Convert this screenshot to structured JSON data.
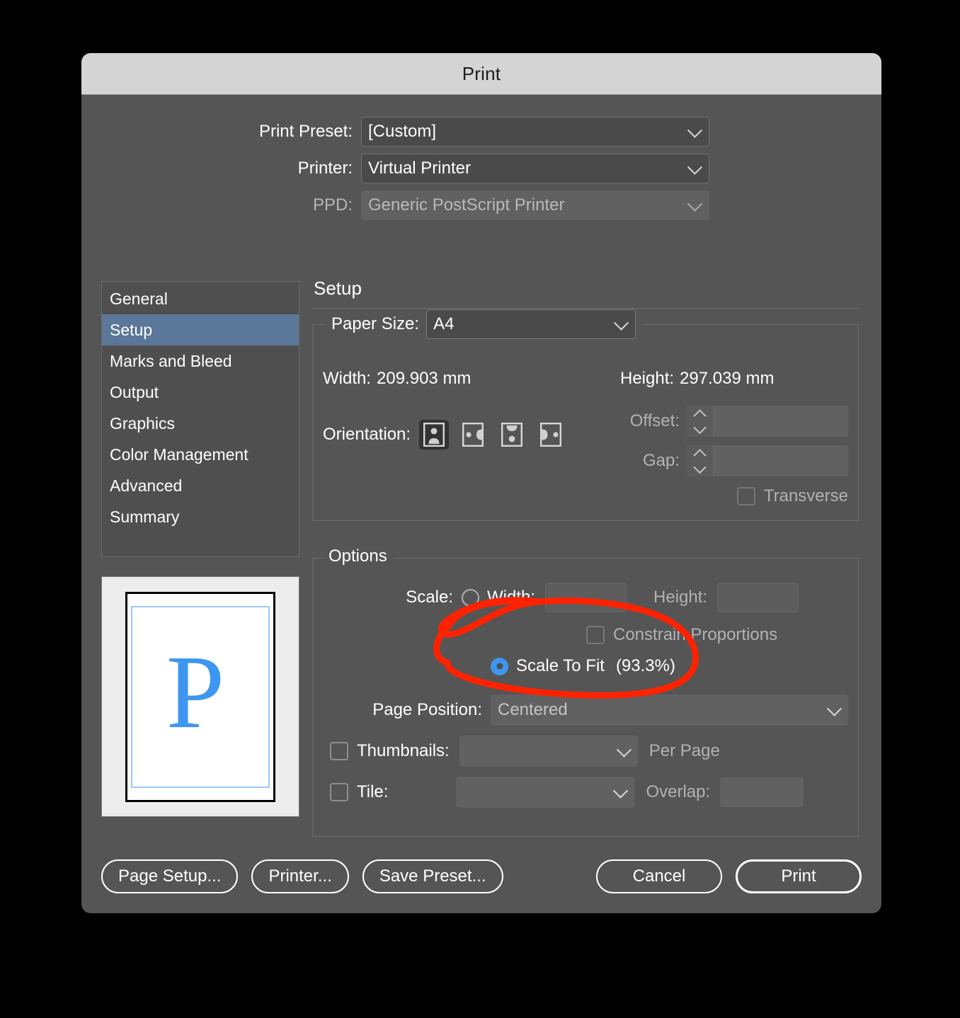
{
  "dialog": {
    "title": "Print"
  },
  "top_fields": [
    {
      "label": "Print Preset:",
      "value": "[Custom]",
      "disabled": false
    },
    {
      "label": "Printer:",
      "value": "Virtual Printer",
      "disabled": false
    },
    {
      "label": "PPD:",
      "value": "Generic PostScript Printer",
      "disabled": true
    }
  ],
  "sidebar": {
    "items": [
      {
        "label": "General",
        "active": false
      },
      {
        "label": "Setup",
        "active": true
      },
      {
        "label": "Marks and Bleed",
        "active": false
      },
      {
        "label": "Output",
        "active": false
      },
      {
        "label": "Graphics",
        "active": false
      },
      {
        "label": "Color Management",
        "active": false
      },
      {
        "label": "Advanced",
        "active": false
      },
      {
        "label": "Summary",
        "active": false
      }
    ]
  },
  "preview": {
    "letter": "P",
    "letter_color": "#3d96f0",
    "guide_color": "#9ac7f5"
  },
  "pane": {
    "title": "Setup"
  },
  "setup": {
    "paper_size_label": "Paper Size:",
    "paper_size_value": "A4",
    "width_label": "Width:",
    "width_value": "209.903 mm",
    "height_label": "Height:",
    "height_value": "297.039 mm",
    "orientation_label": "Orientation:",
    "orientation_options": [
      "portrait-orientation-icon",
      "landscape-orientation-icon",
      "reverse-portrait-orientation-icon",
      "reverse-landscape-orientation-icon"
    ],
    "orientation_selected_index": 0,
    "offset_label": "Offset:",
    "offset_value": "",
    "gap_label": "Gap:",
    "gap_value": "",
    "transverse_label": "Transverse",
    "transverse_checked": false
  },
  "options": {
    "legend": "Options",
    "scale_label": "Scale:",
    "scale_radio_selected": false,
    "scale_width_label": "Width:",
    "scale_width_value": "",
    "scale_height_label": "Height:",
    "scale_height_value": "",
    "constrain_label": "Constrain Proportions",
    "constrain_checked": false,
    "scale_to_fit_selected": true,
    "scale_to_fit_label": "Scale To Fit",
    "scale_to_fit_percent": "(93.3%)",
    "page_position_label": "Page Position:",
    "page_position_value": "Centered",
    "thumbnails_label": "Thumbnails:",
    "thumbnails_checked": false,
    "thumbnails_value": "",
    "per_page_label": "Per Page",
    "tile_label": "Tile:",
    "tile_checked": false,
    "tile_value": "",
    "overlap_label": "Overlap:",
    "overlap_value": ""
  },
  "buttons": {
    "page_setup": "Page Setup...",
    "printer": "Printer...",
    "save_preset": "Save Preset...",
    "cancel": "Cancel",
    "print": "Print"
  },
  "annotation": {
    "color": "#ff2200",
    "target": "Scale To Fit (93.3%)"
  }
}
